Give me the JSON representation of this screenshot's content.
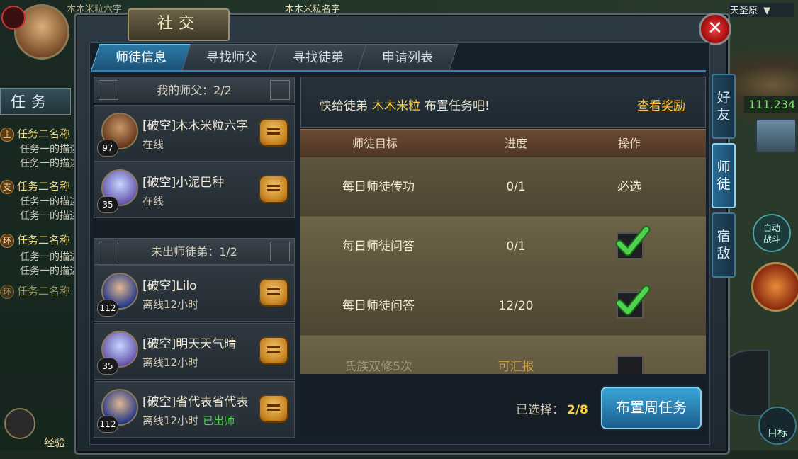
{
  "hud": {
    "top_left_name": "木木米粒六字",
    "target_name": "木木米粒名字",
    "zone": "天圣原",
    "exp_label": "经验",
    "power": "111.234",
    "auto_battle": "自动\n战斗",
    "target_label": "目标",
    "task_tab": "任务",
    "tasks": [
      {
        "badge": "主",
        "title": "任务二名称",
        "lines": [
          "任务一的描述",
          "任务一的描述"
        ]
      },
      {
        "badge": "支",
        "title": "任务二名称",
        "lines": [
          "任务一的描述",
          "任务一的描述"
        ]
      },
      {
        "badge": "环",
        "title": "任务二名称",
        "lines": [
          "任务一的描述",
          "任务一的描述"
        ]
      },
      {
        "badge": "环",
        "title": "任务二名称",
        "lines": []
      }
    ]
  },
  "window": {
    "title": "社交",
    "tabs": [
      "师徒信息",
      "寻找师父",
      "寻找徒弟",
      "申请列表"
    ],
    "active_tab": 0,
    "side_tabs": [
      "好友",
      "师徒",
      "宿敌"
    ],
    "active_side_tab": 1
  },
  "members": {
    "master_header": "我的师父：2/2",
    "disciple_header": "未出师徒弟：1/2",
    "masters": [
      {
        "name": "[破空]木木米粒六字",
        "status": "在线",
        "level": "97",
        "done": ""
      },
      {
        "name": "[破空]小泥巴种",
        "status": "在线",
        "level": "35",
        "done": ""
      }
    ],
    "disciples": [
      {
        "name": "[破空]Lilo",
        "status": "离线12小时",
        "level": "112",
        "done": ""
      },
      {
        "name": "[破空]明天天气晴",
        "status": "离线12小时",
        "level": "35",
        "done": ""
      },
      {
        "name": "[破空]省代表省代表",
        "status": "离线12小时",
        "level": "112",
        "done": "已出师"
      }
    ]
  },
  "tasks_panel": {
    "notice_prefix": "快给徒弟",
    "notice_name": "木木米粒",
    "notice_suffix": "布置任务吧!",
    "reward_link": "查看奖励",
    "columns": [
      "师徒目标",
      "进度",
      "操作"
    ],
    "rows": [
      {
        "goal": "每日师徒传功",
        "progress": "0/1",
        "action": "必选",
        "checked": false,
        "dim": false
      },
      {
        "goal": "每日师徒问答",
        "progress": "0/1",
        "action": "",
        "checked": true,
        "dim": false
      },
      {
        "goal": "每日师徒问答",
        "progress": "12/20",
        "action": "",
        "checked": true,
        "dim": false
      },
      {
        "goal": "氏族双修5次",
        "progress": "可汇报",
        "action": "",
        "checked": false,
        "dim": true
      }
    ],
    "selected_label": "已选择：",
    "selected_value": "2/8",
    "assign_button": "布置周任务"
  },
  "colors": {
    "accent_blue": "#2b86b8",
    "highlight_yellow": "#ffd23a",
    "done_green": "#4bd14b",
    "close_red": "#d22"
  }
}
